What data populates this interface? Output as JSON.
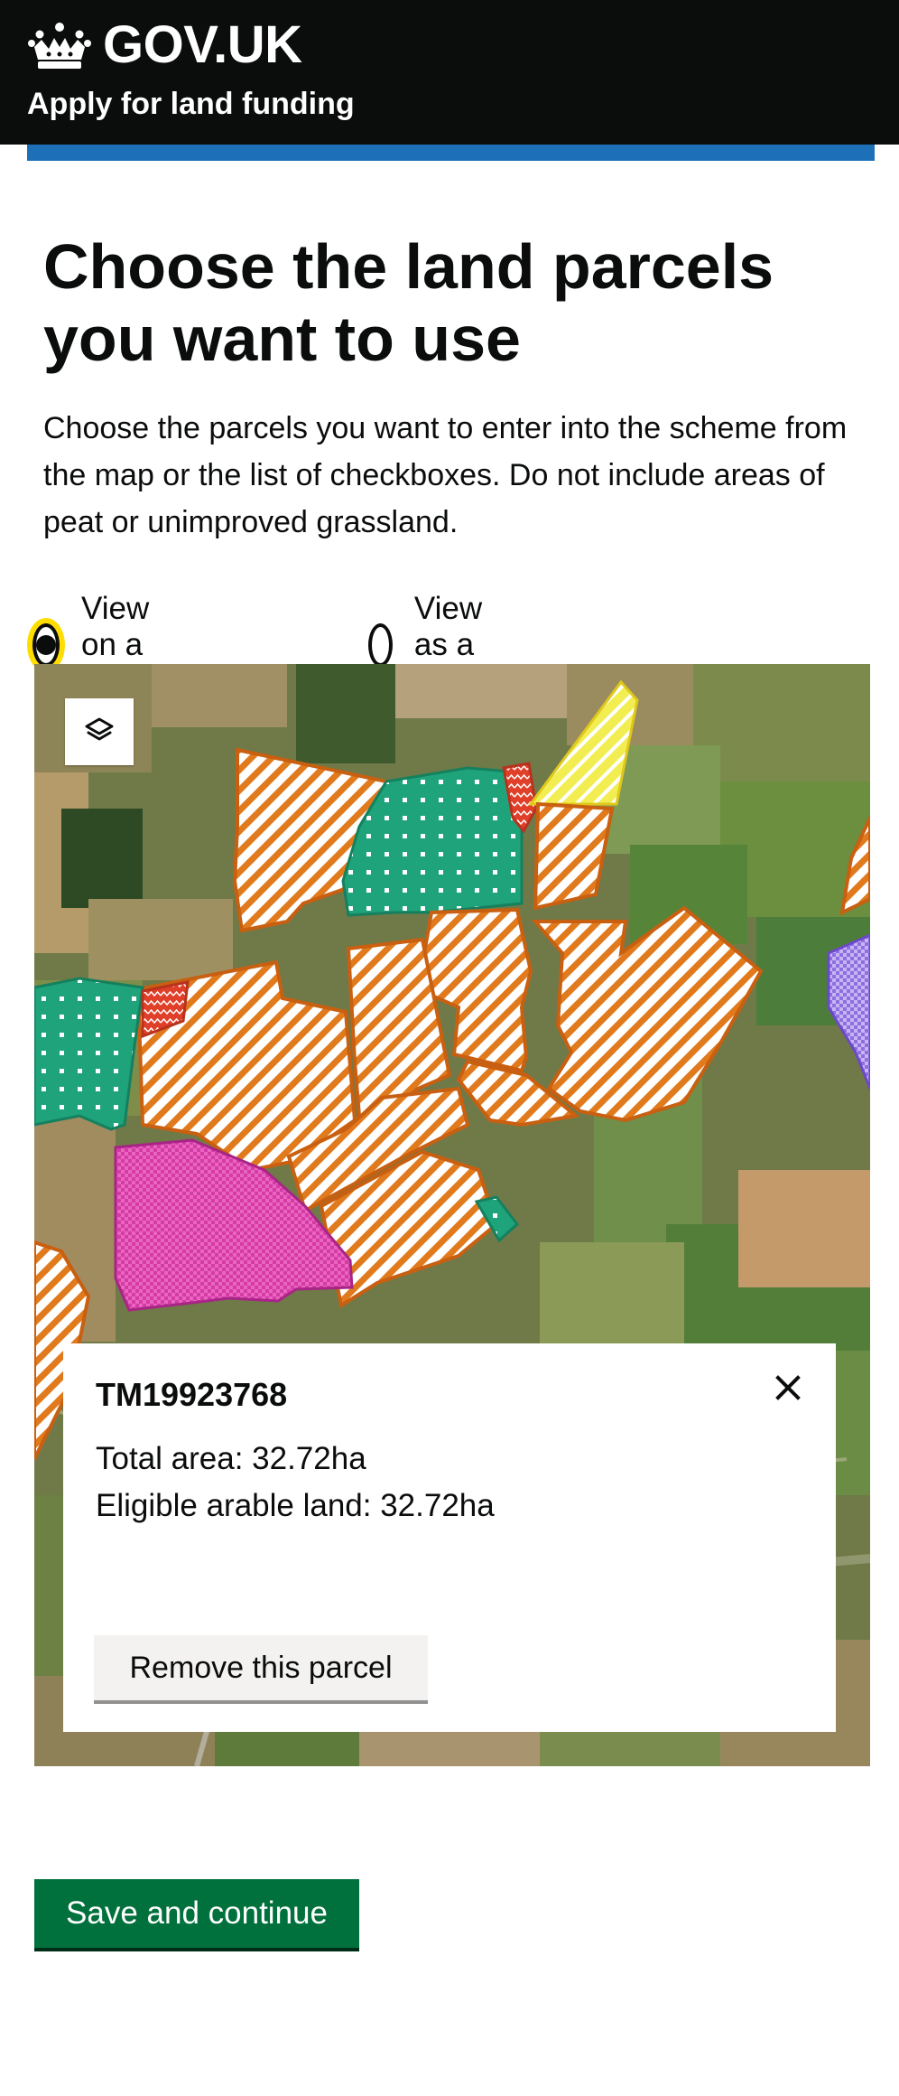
{
  "header": {
    "brand": "GOV.UK",
    "service_name": "Apply for land funding",
    "logo_icon": "crown-icon",
    "accent_color": "#1d70b8"
  },
  "page": {
    "title": "Choose the land parcels you want to use",
    "lede": "Choose the parcels you want to enter into the scheme from the map or the list of checkboxes. Do not include areas of peat or unimproved grassland."
  },
  "view_toggle": {
    "options": [
      {
        "label": "View on a map",
        "selected": true
      },
      {
        "label": "View as a list",
        "selected": false
      }
    ]
  },
  "map": {
    "layers_icon": "layers-icon",
    "popup": {
      "parcel_id": "TM19923768",
      "total_area": "Total area: 32.72ha",
      "eligible_land": "Eligible arable land: 32.72ha",
      "remove_label": "Remove this parcel",
      "close_icon": "close-icon"
    }
  },
  "actions": {
    "save_label": "Save and continue",
    "save_color": "#00703c"
  }
}
